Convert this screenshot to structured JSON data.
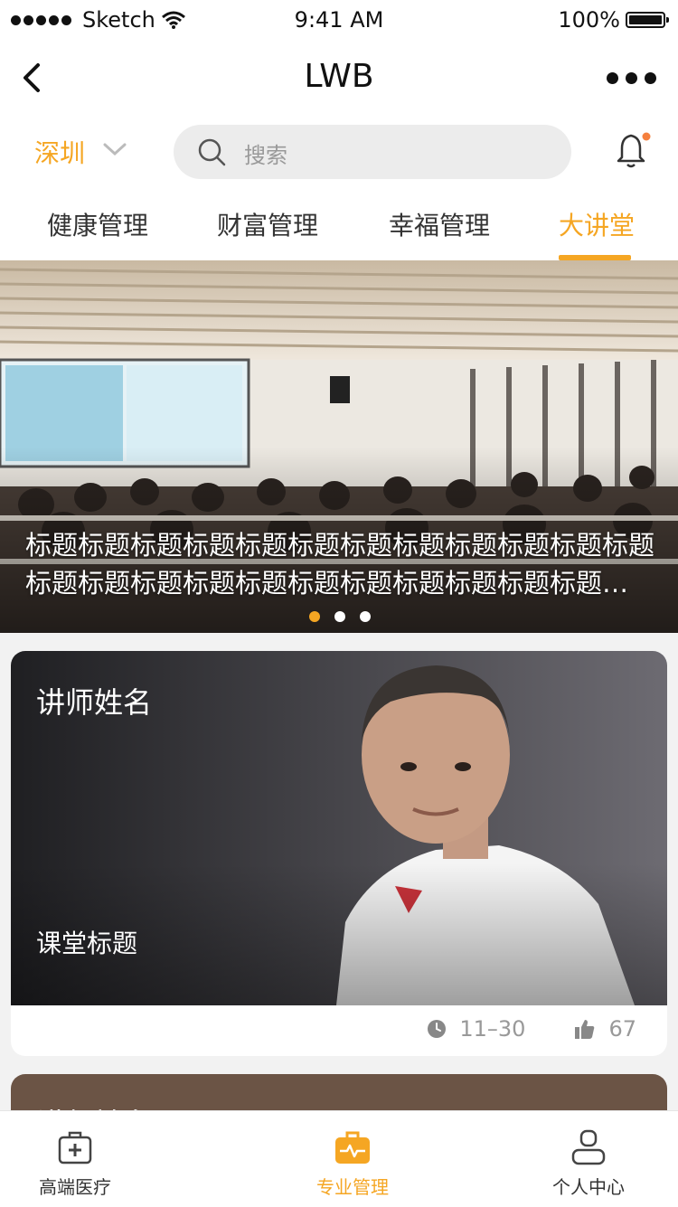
{
  "status_bar": {
    "carrier": "Sketch",
    "time": "9:41 AM",
    "battery": "100%"
  },
  "nav": {
    "title": "LWB",
    "back_icon": "chevron-left-icon",
    "more_icon": "more-icon"
  },
  "search_row": {
    "city": "深圳",
    "search_placeholder": "搜索"
  },
  "tabs": [
    {
      "label": "健康管理"
    },
    {
      "label": "财富管理"
    },
    {
      "label": "幸福管理"
    },
    {
      "label": "大讲堂",
      "active": true
    }
  ],
  "banner": {
    "caption": "标题标题标题标题标题标题标题标题标题标题标题标题标题标题标题标题标题标题标题标题标题标题标题…",
    "page_count": 3,
    "active_page": 1
  },
  "lecture_cards": [
    {
      "teacher_name": "讲师姓名",
      "course_title": "课堂标题",
      "date": "11–30",
      "likes": "67"
    },
    {
      "teacher_name": "讲师姓名"
    }
  ],
  "tab_bar": [
    {
      "label": "高端医疗",
      "icon": "medical-kit-icon"
    },
    {
      "label": "专业管理",
      "icon": "briefcase-pulse-icon",
      "active": true
    },
    {
      "label": "个人中心",
      "icon": "user-icon"
    }
  ],
  "colors": {
    "accent": "#f5a623",
    "text": "#333333",
    "muted": "#999999"
  }
}
